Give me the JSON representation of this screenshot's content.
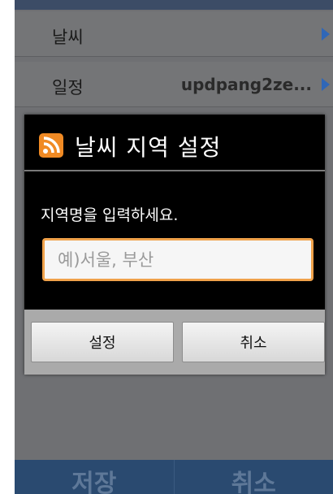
{
  "settings": {
    "rows": [
      {
        "label": "날씨",
        "value": ""
      },
      {
        "label": "일정",
        "value": "updpang2ze..."
      }
    ]
  },
  "bottom_bar": {
    "save_label": "저장",
    "cancel_label": "취소"
  },
  "dialog": {
    "icon": "rss-icon",
    "title": "날씨 지역 설정",
    "message": "지역명을 입력하세요.",
    "input_value": "",
    "input_placeholder": "예)서울, 부산",
    "ok_label": "설정",
    "cancel_label": "취소"
  },
  "colors": {
    "input_focus_border": "#f0a24a",
    "rss_orange": "#f08a24",
    "arrow_blue": "#2f67b8",
    "bottom_bar": "#2a4a70"
  }
}
